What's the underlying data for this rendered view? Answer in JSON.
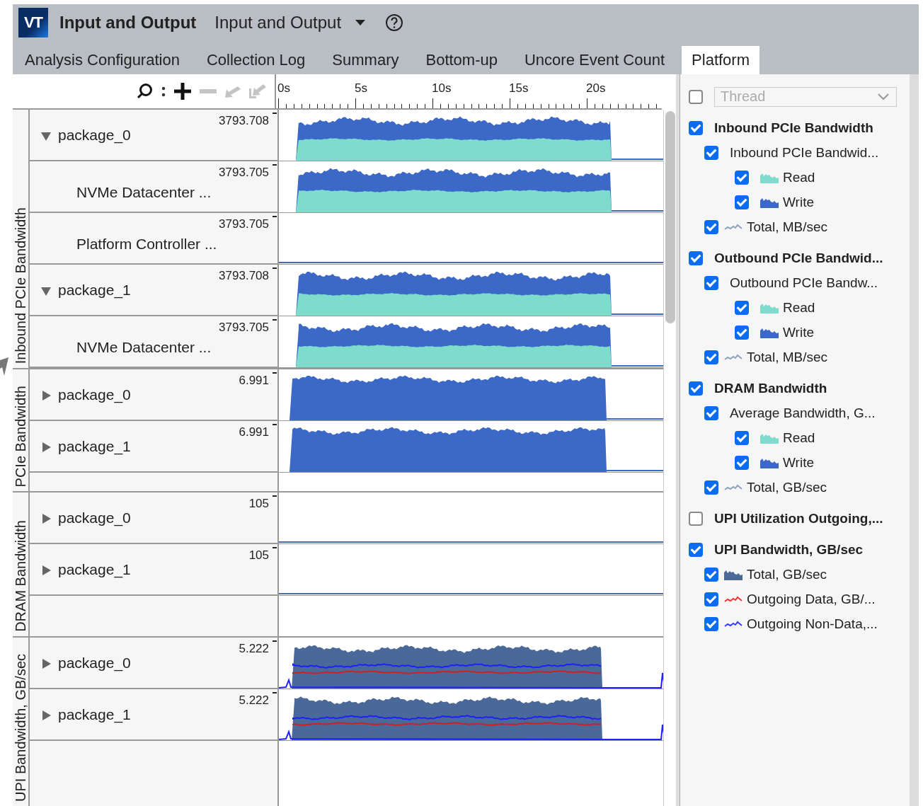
{
  "app": {
    "logo": "VT",
    "title": "Input and Output",
    "view": "Input and Output"
  },
  "tabs": [
    {
      "label": "Analysis Configuration",
      "selected": false
    },
    {
      "label": "Collection Log",
      "selected": false
    },
    {
      "label": "Summary",
      "selected": false
    },
    {
      "label": "Bottom-up",
      "selected": false
    },
    {
      "label": "Uncore Event Count",
      "selected": false
    },
    {
      "label": "Platform",
      "selected": true
    }
  ],
  "toolbar": [
    {
      "kind": "search",
      "disabled": false
    },
    {
      "kind": "zoom-in",
      "disabled": false
    },
    {
      "kind": "zoom-out",
      "disabled": true
    },
    {
      "kind": "undo",
      "disabled": true
    },
    {
      "kind": "reset",
      "disabled": true
    }
  ],
  "ruler": {
    "ticks": [
      "0s",
      "5s",
      "10s",
      "15s",
      "20s"
    ]
  },
  "groups": [
    {
      "label": "Inbound PCIe Bandwidth",
      "rows": [
        {
          "name": "package_0",
          "max": "3793.708",
          "expanded": true,
          "kind": "read-write",
          "children": [
            {
              "name": "NVMe Datacenter ...",
              "max": "3793.705",
              "kind": "read-write"
            },
            {
              "name": "Platform Controller ...",
              "max": "3793.705",
              "kind": "flat"
            }
          ]
        },
        {
          "name": "package_1",
          "max": "3793.708",
          "expanded": true,
          "kind": "read-write",
          "children": [
            {
              "name": "NVMe Datacenter ...",
              "max": "3793.705",
              "kind": "read-write"
            }
          ]
        }
      ]
    },
    {
      "label": "PCIe Bandwidth",
      "rows": [
        {
          "name": "package_0",
          "max": "6.991",
          "expanded": false,
          "kind": "write"
        },
        {
          "name": "package_1",
          "max": "6.991",
          "expanded": false,
          "kind": "write"
        }
      ]
    },
    {
      "label": "DRAM Bandwidth",
      "rows": [
        {
          "name": "package_0",
          "max": "105",
          "expanded": false,
          "kind": "flat"
        },
        {
          "name": "package_1",
          "max": "105",
          "expanded": false,
          "kind": "flat"
        }
      ]
    },
    {
      "label": "UPI Bandwidth, GB/sec",
      "rows": [
        {
          "name": "package_0",
          "max": "5.222",
          "expanded": false,
          "kind": "upi"
        },
        {
          "name": "package_1",
          "max": "5.222",
          "expanded": false,
          "kind": "upi"
        }
      ]
    }
  ],
  "legend": {
    "thread_filter": {
      "checked": false,
      "placeholder": "Thread",
      "disabled": true
    },
    "items": [
      {
        "label": "Inbound PCIe Bandwidth",
        "checked": true,
        "children": [
          {
            "label": "Inbound PCIe Bandwid...",
            "checked": true,
            "children": [
              {
                "label": "Read",
                "checked": true,
                "kind": "area",
                "color": "#7ddccb"
              },
              {
                "label": "Write",
                "checked": true,
                "kind": "area",
                "color": "#3c68c8"
              }
            ]
          },
          {
            "label": "Total, MB/sec",
            "checked": true,
            "kind": "line",
            "color": "#8ea2c0"
          }
        ]
      },
      {
        "label": "Outbound PCIe Bandwid...",
        "checked": true,
        "children": [
          {
            "label": "Outbound PCIe Bandw...",
            "checked": true,
            "children": [
              {
                "label": "Read",
                "checked": true,
                "kind": "area",
                "color": "#7ddccb"
              },
              {
                "label": "Write",
                "checked": true,
                "kind": "area",
                "color": "#3c68c8"
              }
            ]
          },
          {
            "label": "Total, MB/sec",
            "checked": true,
            "kind": "line",
            "color": "#8ea2c0"
          }
        ]
      },
      {
        "label": "DRAM Bandwidth",
        "checked": true,
        "children": [
          {
            "label": "Average Bandwidth, G...",
            "checked": true,
            "children": [
              {
                "label": "Read",
                "checked": true,
                "kind": "area",
                "color": "#7ddccb"
              },
              {
                "label": "Write",
                "checked": true,
                "kind": "area",
                "color": "#3c68c8"
              }
            ]
          },
          {
            "label": "Total, GB/sec",
            "checked": true,
            "kind": "line",
            "color": "#8ea2c0"
          }
        ]
      },
      {
        "label": "UPI Utilization Outgoing,...",
        "checked": false
      },
      {
        "label": "UPI Bandwidth, GB/sec",
        "checked": true,
        "children": [
          {
            "label": "Total, GB/sec",
            "checked": true,
            "kind": "area",
            "color": "#4a6898"
          },
          {
            "label": "Outgoing Data, GB/...",
            "checked": true,
            "kind": "line",
            "color": "#ff3030"
          },
          {
            "label": "Outgoing Non-Data,...",
            "checked": true,
            "kind": "line",
            "color": "#3a3aff"
          }
        ]
      }
    ]
  }
}
